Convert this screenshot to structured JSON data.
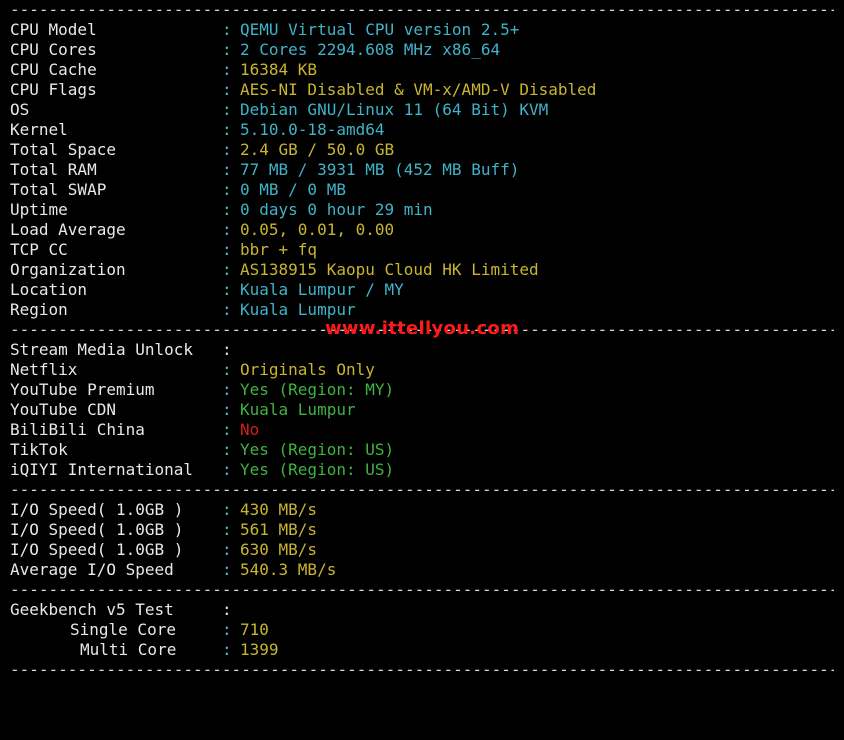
{
  "dividers": {
    "line": "------------------------------------------------------------------------------------------------------------------------"
  },
  "system_info": [
    {
      "label": "CPU Model",
      "value": "QEMU Virtual CPU version 2.5+"
    },
    {
      "label": "CPU Cores",
      "value": "2 Cores 2294.608 MHz x86_64"
    },
    {
      "label": "CPU Cache",
      "value": "16384 KB"
    },
    {
      "label": "CPU Flags",
      "value": "AES-NI Disabled & VM-x/AMD-V Disabled"
    },
    {
      "label": "OS",
      "value": "Debian GNU/Linux 11 (64 Bit) KVM"
    },
    {
      "label": "Kernel",
      "value": "5.10.0-18-amd64"
    },
    {
      "label": "Total Space",
      "value": "2.4 GB / 50.0 GB"
    },
    {
      "label": "Total RAM",
      "value": "77 MB / 3931 MB (452 MB Buff)"
    },
    {
      "label": "Total SWAP",
      "value": "0 MB / 0 MB"
    },
    {
      "label": "Uptime",
      "value": "0 days 0 hour 29 min"
    },
    {
      "label": "Load Average",
      "value": "0.05, 0.01, 0.00"
    },
    {
      "label": "TCP CC",
      "value": "bbr + fq"
    },
    {
      "label": "Organization",
      "value": "AS138915 Kaopu Cloud HK Limited"
    },
    {
      "label": "Location",
      "value": "Kuala Lumpur / MY"
    },
    {
      "label": "Region",
      "value": "Kuala Lumpur"
    }
  ],
  "stream_media": {
    "header": "Stream Media Unlock",
    "items": [
      {
        "label": "Netflix",
        "value": "Originals Only"
      },
      {
        "label": "YouTube Premium",
        "value": "Yes (Region: MY)"
      },
      {
        "label": "YouTube CDN",
        "value": "Kuala Lumpur"
      },
      {
        "label": "BiliBili China",
        "value": "No"
      },
      {
        "label": "TikTok",
        "value": "Yes (Region: US)"
      },
      {
        "label": "iQIYI International",
        "value": "Yes (Region: US)"
      }
    ]
  },
  "io_speed": [
    {
      "label": "I/O Speed( 1.0GB )",
      "value": "430 MB/s"
    },
    {
      "label": "I/O Speed( 1.0GB )",
      "value": "561 MB/s"
    },
    {
      "label": "I/O Speed( 1.0GB )",
      "value": "630 MB/s"
    },
    {
      "label": "Average I/O Speed",
      "value": "540.3 MB/s"
    }
  ],
  "geekbench": {
    "header": "Geekbench v5 Test",
    "single_label": "Single Core",
    "single_value": "710",
    "multi_label": "Multi Core",
    "multi_value": "1399"
  },
  "separator": ":",
  "watermark": "www.ittellyou.com",
  "colors": {
    "background": "#000000",
    "label": "#e8e8e8",
    "cyan": "#3fb3c8",
    "yellow": "#c9b52e",
    "green": "#3fb33f",
    "red": "#d21e1e",
    "watermark": "#ff1a1a"
  }
}
